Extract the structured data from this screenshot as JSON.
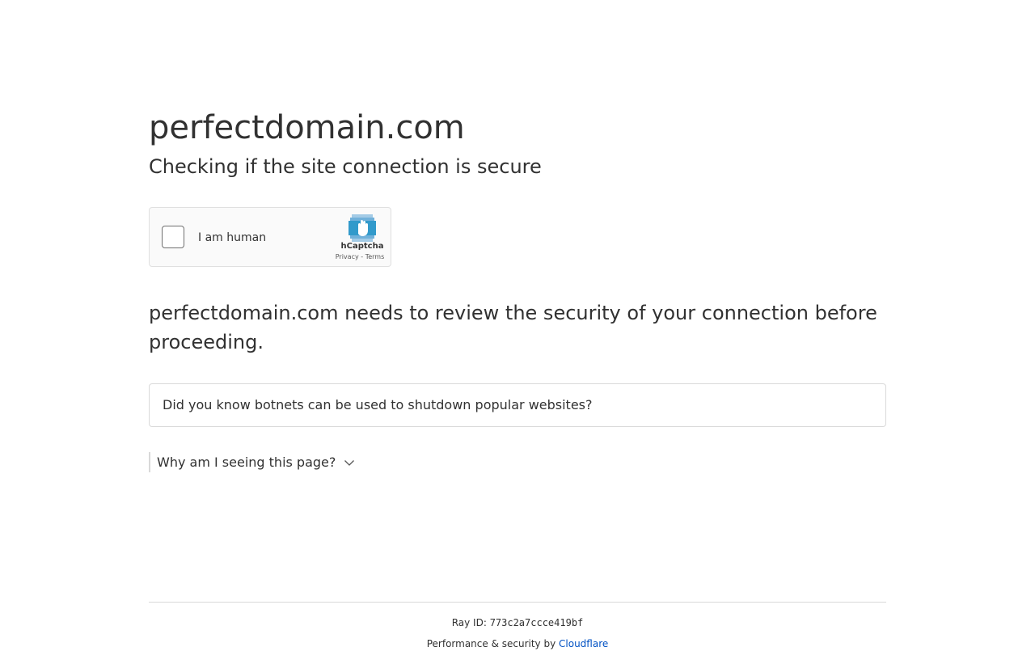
{
  "header": {
    "site_title": "perfectdomain.com",
    "subtitle": "Checking if the site connection is secure"
  },
  "captcha": {
    "label": "I am human",
    "brand": "hCaptcha",
    "privacy_link": "Privacy",
    "separator": " - ",
    "terms_link": "Terms",
    "logo_icon": "hcaptcha-hand-icon",
    "logo_color": "#0074bf"
  },
  "main": {
    "lead_text": "perfectdomain.com needs to review the security of your connection before proceeding.",
    "tip_text": "Did you know botnets can be used to shutdown popular websites?",
    "why_label": "Why am I seeing this page?",
    "why_icon": "chevron-down-icon"
  },
  "footer": {
    "ray_label": "Ray ID: ",
    "ray_id": "773c2a7ccce419bf",
    "perf_label": "Performance & security by ",
    "provider_link": "Cloudflare",
    "link_color": "#0051c3"
  }
}
